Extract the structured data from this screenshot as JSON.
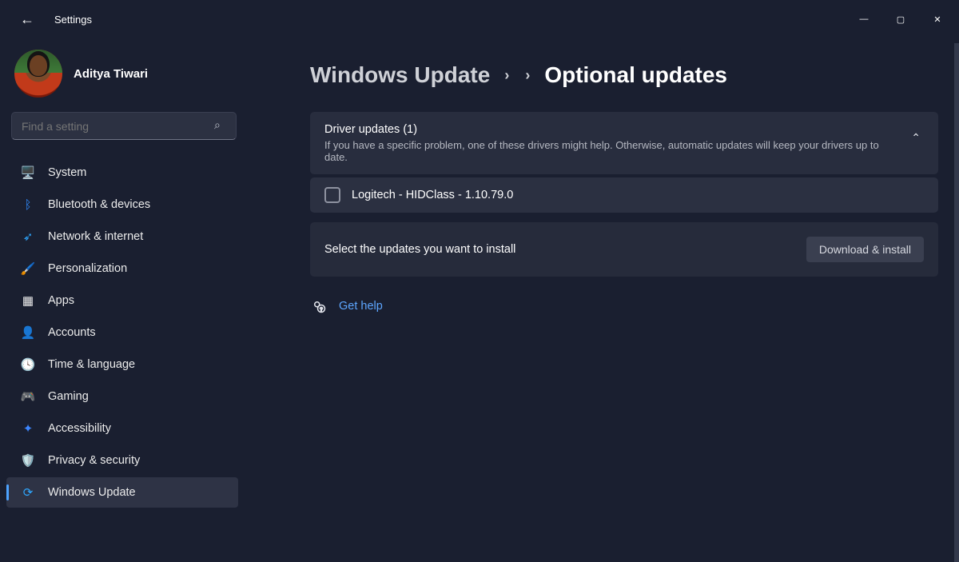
{
  "app_title": "Settings",
  "window_controls": {
    "min": "—",
    "max": "▢",
    "close": "✕"
  },
  "user": {
    "name": "Aditya Tiwari"
  },
  "search": {
    "placeholder": "Find a setting"
  },
  "sidebar": {
    "items": [
      {
        "id": "system",
        "label": "System",
        "icon": "🖥️",
        "selected": false
      },
      {
        "id": "bluetooth",
        "label": "Bluetooth & devices",
        "icon": "ᛒ",
        "selected": false,
        "iconColor": "#2e8bff"
      },
      {
        "id": "network",
        "label": "Network & internet",
        "icon": "➶",
        "selected": false,
        "iconColor": "#2ea7ff"
      },
      {
        "id": "personalize",
        "label": "Personalization",
        "icon": "🖌️",
        "selected": false
      },
      {
        "id": "apps",
        "label": "Apps",
        "icon": "▦",
        "selected": false
      },
      {
        "id": "accounts",
        "label": "Accounts",
        "icon": "👤",
        "selected": false,
        "iconColor": "#43c86b"
      },
      {
        "id": "time",
        "label": "Time & language",
        "icon": "🕓",
        "selected": false
      },
      {
        "id": "gaming",
        "label": "Gaming",
        "icon": "🎮",
        "selected": false
      },
      {
        "id": "accessibility",
        "label": "Accessibility",
        "icon": "✦",
        "selected": false,
        "iconColor": "#3d86ff"
      },
      {
        "id": "privacy",
        "label": "Privacy & security",
        "icon": "🛡️",
        "selected": false
      },
      {
        "id": "update",
        "label": "Windows Update",
        "icon": "⟳",
        "selected": true,
        "iconColor": "#2ea7ff"
      }
    ]
  },
  "breadcrumb": {
    "parent": "Windows Update",
    "current": "Optional updates"
  },
  "driver_section": {
    "title": "Driver updates (1)",
    "subtitle": "If you have a specific problem, one of these drivers might help. Otherwise, automatic updates will keep your drivers up to date.",
    "items": [
      {
        "label": "Logitech - HIDClass - 1.10.79.0",
        "checked": false
      }
    ]
  },
  "action_bar": {
    "text": "Select the updates you want to install",
    "button": "Download & install"
  },
  "help": {
    "label": "Get help"
  }
}
